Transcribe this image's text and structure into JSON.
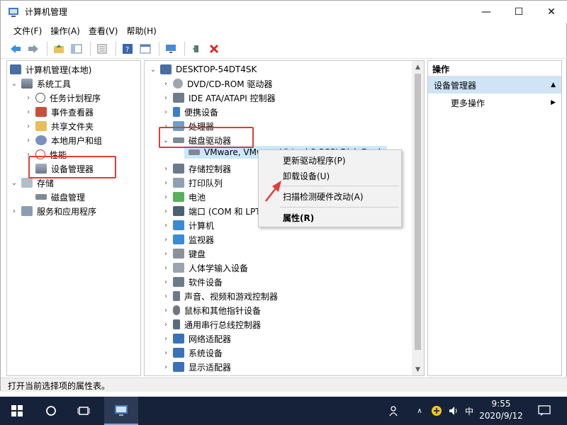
{
  "window": {
    "title": "计算机管理",
    "minimize": "—",
    "maximize": "☐",
    "close": "✕"
  },
  "menu": [
    "文件(F)",
    "操作(A)",
    "查看(V)",
    "帮助(H)"
  ],
  "left_tree": {
    "root": "计算机管理(本地)",
    "system_tools": "系统工具",
    "task_scheduler": "任务计划程序",
    "event_viewer": "事件查看器",
    "shared_folders": "共享文件夹",
    "local_users": "本地用户和组",
    "performance": "性能",
    "device_manager": "设备管理器",
    "storage": "存储",
    "disk_management": "磁盘管理",
    "services_apps": "服务和应用程序"
  },
  "device_tree": {
    "computer": "DESKTOP-54DT4SK",
    "items": [
      "DVD/CD-ROM 驱动器",
      "IDE ATA/ATAPI 控制器",
      "便携设备",
      "处理器",
      "磁盘驱动器",
      "存储控制器",
      "打印队列",
      "电池",
      "端口 (COM 和 LPT)",
      "计算机",
      "监视器",
      "键盘",
      "人体学输入设备",
      "软件设备",
      "声音、视频和游戏控制器",
      "鼠标和其他指针设备",
      "通用串行总线控制器",
      "网络适配器",
      "系统设备",
      "显示适配器"
    ],
    "disk_child": "VMware, VMware Virtual S SCSI Disk Device"
  },
  "context_menu": {
    "update_driver": "更新驱动程序(P)",
    "uninstall": "卸载设备(U)",
    "scan": "扫描检测硬件改动(A)",
    "properties": "属性(R)"
  },
  "actions": {
    "header": "操作",
    "section": "设备管理器",
    "more": "更多操作"
  },
  "status": "打开当前选择项的属性表。",
  "taskbar": {
    "time": "9:55",
    "date": "2020/9/12",
    "ime": "中"
  },
  "colors": {
    "highlight_red": "#e23b3b",
    "selection_blue": "#cce8ff",
    "taskbar_bg": "#16223a"
  }
}
